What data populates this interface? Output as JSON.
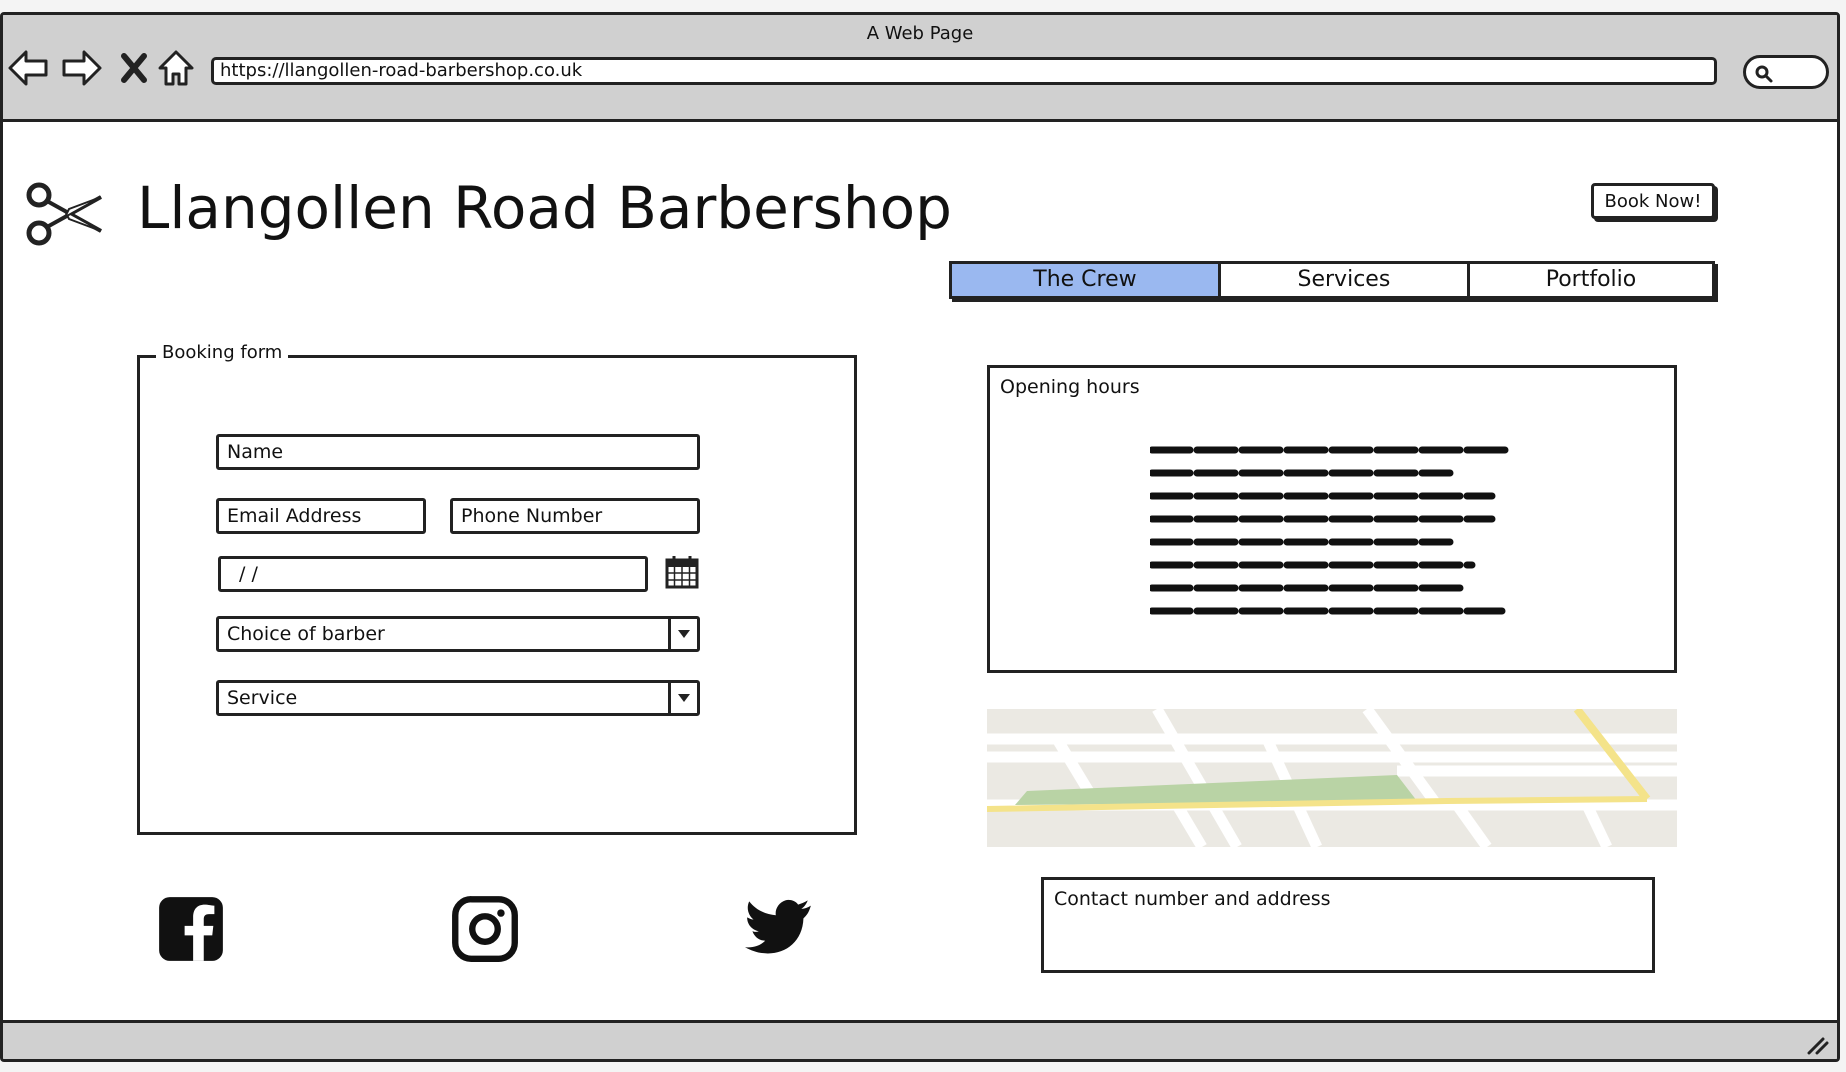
{
  "window": {
    "title": "A Web Page"
  },
  "browser": {
    "url": "https://llangollen-road-barbershop.co.uk",
    "icons": [
      "back-arrow-icon",
      "forward-arrow-icon",
      "stop-icon",
      "home-icon",
      "search-icon"
    ]
  },
  "header": {
    "logo_icon": "scissors-icon",
    "title": "Llangollen Road Barbershop",
    "book_label": "Book Now!"
  },
  "tabs": [
    {
      "label": "The Crew",
      "active": true
    },
    {
      "label": "Services",
      "active": false
    },
    {
      "label": "Portfolio",
      "active": false
    }
  ],
  "accent_color": "#9ab8f0",
  "booking": {
    "legend": "Booking form",
    "name_placeholder": "Name",
    "email_placeholder": "Email Address",
    "phone_placeholder": "Phone Number",
    "date_value": " /  /",
    "barber_select": "Choice of barber",
    "service_select": "Service"
  },
  "opening_hours": {
    "label": "Opening hours"
  },
  "contact": {
    "label": "Contact number and address"
  },
  "social": [
    "facebook-icon",
    "instagram-icon",
    "twitter-icon"
  ]
}
